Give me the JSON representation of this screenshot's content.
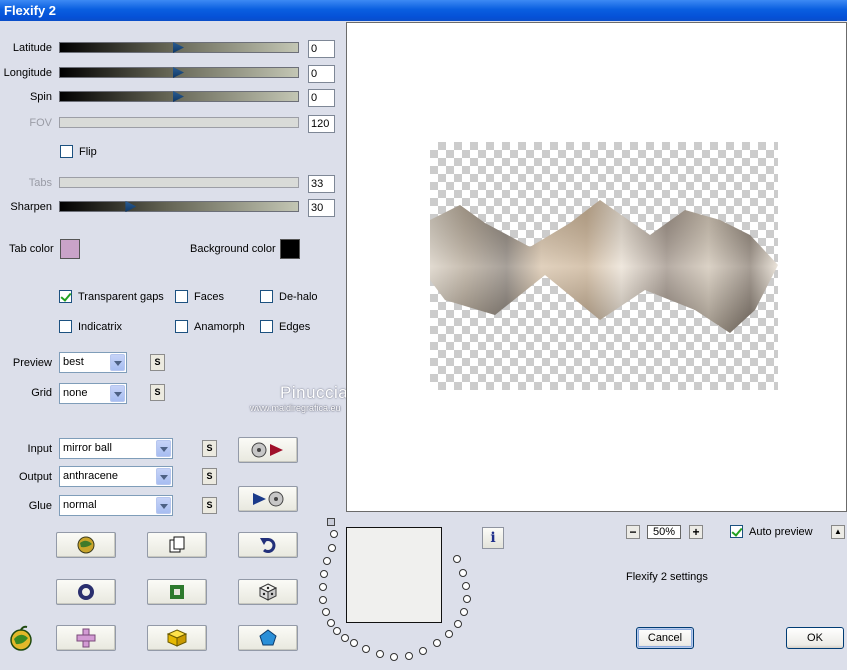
{
  "window": {
    "title": "Flexify 2"
  },
  "params": {
    "latitude": {
      "label": "Latitude",
      "value": "0",
      "level": 0.5
    },
    "longitude": {
      "label": "Longitude",
      "value": "0",
      "level": 0.5
    },
    "spin": {
      "label": "Spin",
      "value": "0",
      "level": 0.5
    },
    "fov": {
      "label": "FOV",
      "value": "120",
      "enabled": false
    },
    "flip": {
      "label": "Flip",
      "checked": false
    },
    "tabs": {
      "label": "Tabs",
      "value": "33",
      "enabled": false
    },
    "sharpen": {
      "label": "Sharpen",
      "value": "30",
      "level": 0.3
    }
  },
  "colors": {
    "tab_color_label": "Tab color",
    "tab_color": "#c9a3c8",
    "background_color_label": "Background color",
    "background_color": "#000000"
  },
  "options": {
    "transparent_gaps": {
      "label": "Transparent gaps",
      "checked": true
    },
    "faces": {
      "label": "Faces",
      "checked": false
    },
    "de_halo": {
      "label": "De-halo",
      "checked": false
    },
    "indicatrix": {
      "label": "Indicatrix",
      "checked": false
    },
    "anamorph": {
      "label": "Anamorph",
      "checked": false
    },
    "edges": {
      "label": "Edges",
      "checked": false
    }
  },
  "dropdowns": {
    "preview": {
      "label": "Preview",
      "value": "best"
    },
    "grid": {
      "label": "Grid",
      "value": "none"
    },
    "input": {
      "label": "Input",
      "value": "mirror ball"
    },
    "output": {
      "label": "Output",
      "value": "anthracene"
    },
    "glue": {
      "label": "Glue",
      "value": "normal"
    },
    "s_button_label": "S"
  },
  "watermark": {
    "name": "Pinuccia",
    "url": "www.maidiregrafica.eu"
  },
  "zoom": {
    "minus": "−",
    "value": "50%",
    "plus": "+"
  },
  "auto_preview": {
    "label": "Auto preview",
    "checked": true
  },
  "scroll_up": "▲",
  "info_button": "i",
  "settings_label": "Flexify 2 settings",
  "buttons": {
    "cancel": "Cancel",
    "ok": "OK"
  },
  "icons": [
    "mirror-ball-icon",
    "film-play-icon",
    "play-film-icon",
    "globe-icon",
    "copy-icon",
    "undo-icon",
    "ring-icon",
    "square-icon",
    "dice-icon",
    "plus-icon",
    "cube-icon",
    "pentagon-icon",
    "apple-logo-icon"
  ]
}
